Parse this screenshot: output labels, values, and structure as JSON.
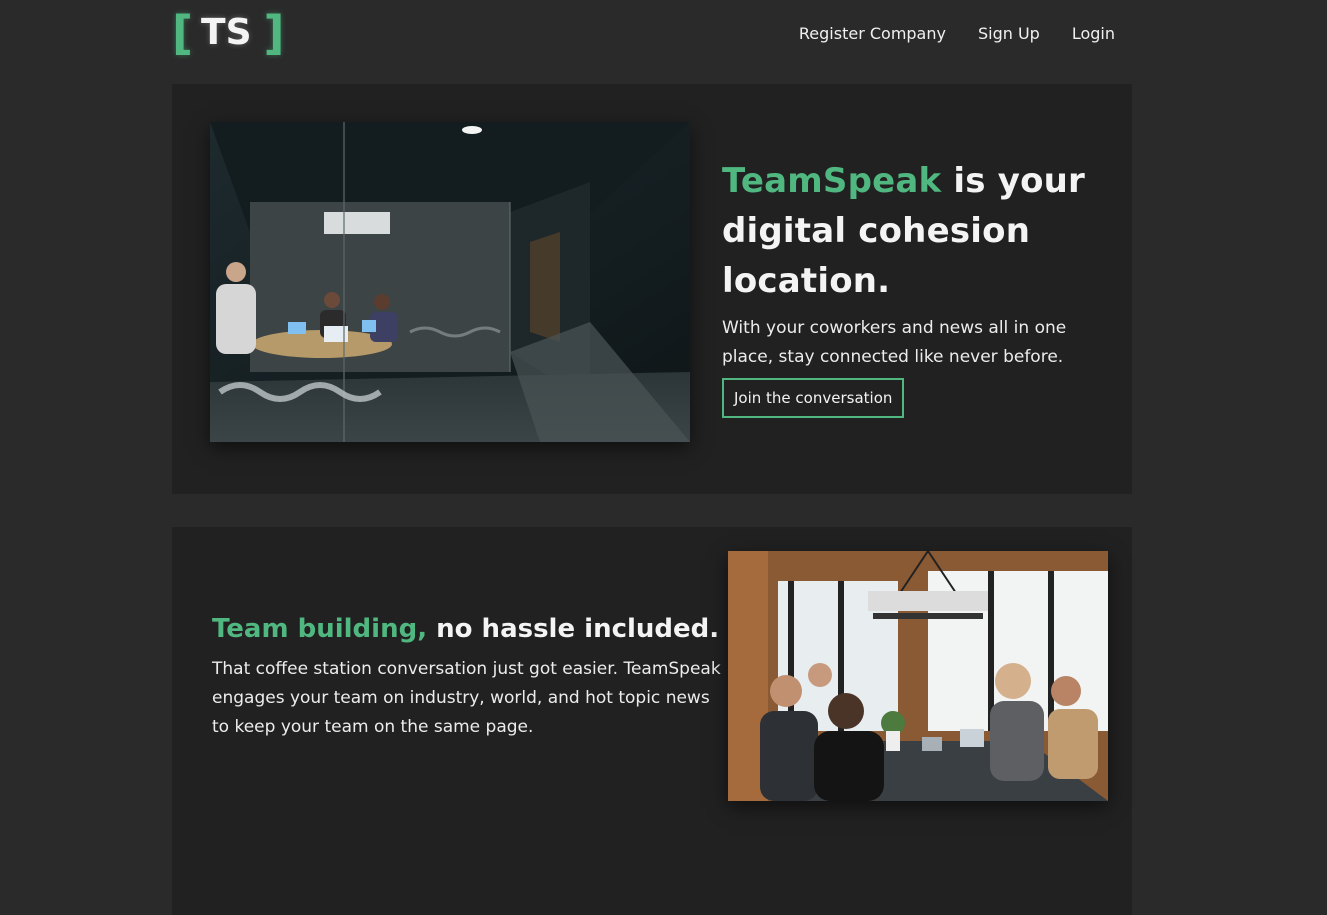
{
  "header": {
    "logo_text": "TS",
    "logo_bracket_left": "[",
    "logo_bracket_right": "]",
    "nav": {
      "register_label": "Register Company",
      "signup_label": "Sign Up",
      "login_label": "Login"
    }
  },
  "hero": {
    "title_accent": "TeamSpeak",
    "title_rest": " is your digital cohesion location.",
    "subtitle": "With your coworkers and news all in one place, stay connected like never before.",
    "cta_label": "Join the conversation",
    "image_icon": "office-photo"
  },
  "section": {
    "title_accent": "Team building,",
    "title_rest": " no hassle included.",
    "body": "That coffee station conversation just got easier. TeamSpeak engages your team on industry, world, and hot topic news to keep your team on the same page.",
    "image_icon": "team-meeting-photo"
  },
  "colors": {
    "accent": "#4fb77f",
    "background": "#2a2a2a",
    "card": "#212121",
    "text": "#f2f2f2"
  }
}
